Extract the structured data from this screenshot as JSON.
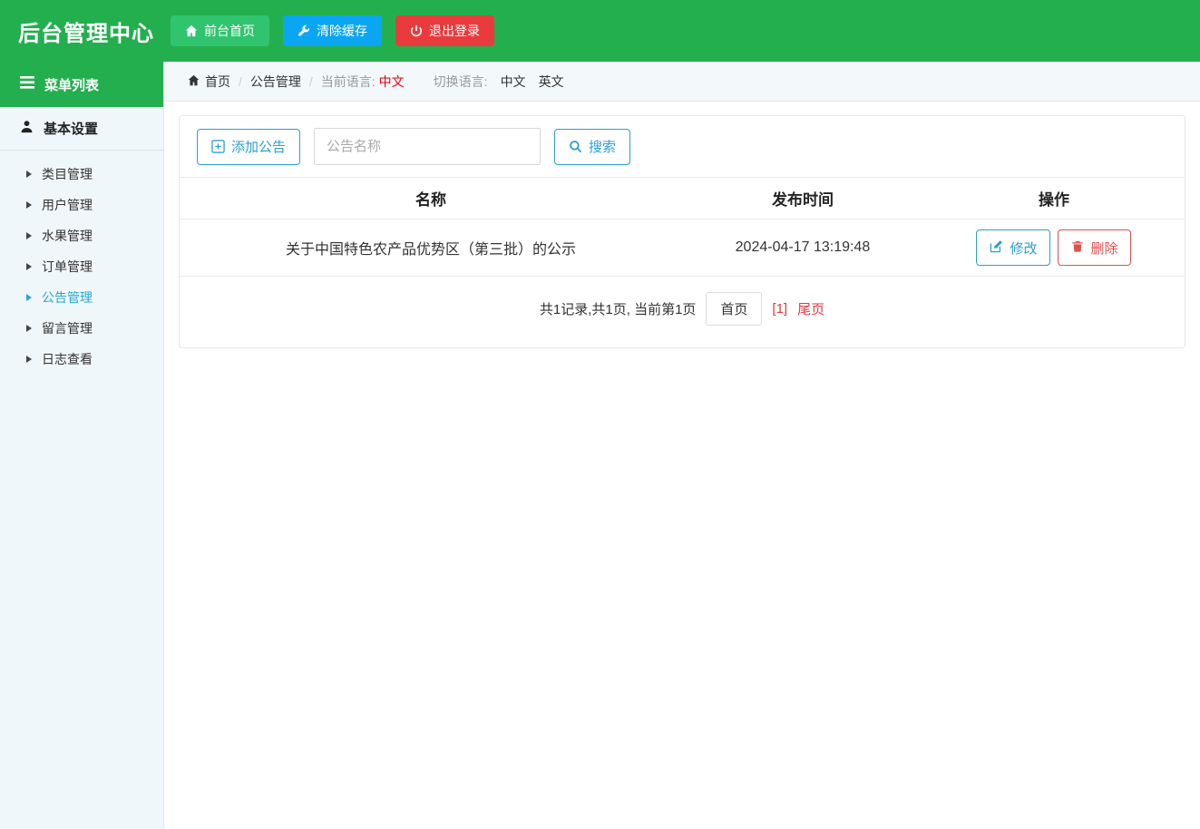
{
  "colors": {
    "header_green": "#24af4f",
    "button_green": "#30c46f",
    "button_blue": "#0aa6f2",
    "button_red": "#e93b3d",
    "accent_blue": "#2b9fd2",
    "active_menu_blue": "#2ba7cd",
    "danger_red": "#dd514c",
    "pager_red": "#e4393c",
    "lang_red": "#e60012",
    "sidebar_bg": "#f0f7fa"
  },
  "header": {
    "title": "后台管理中心",
    "buttons": [
      {
        "label": "前台首页",
        "icon": "home-icon"
      },
      {
        "label": "清除缓存",
        "icon": "wrench-icon"
      },
      {
        "label": "退出登录",
        "icon": "power-icon"
      }
    ]
  },
  "sidebar": {
    "menu_title": "菜单列表",
    "menu_title_icon": "list-icon",
    "group_title": "基本设置",
    "group_icon": "user-icon",
    "items": [
      {
        "label": "类目管理",
        "active": false
      },
      {
        "label": "用户管理",
        "active": false
      },
      {
        "label": "水果管理",
        "active": false
      },
      {
        "label": "订单管理",
        "active": false
      },
      {
        "label": "公告管理",
        "active": true
      },
      {
        "label": "留言管理",
        "active": false
      },
      {
        "label": "日志查看",
        "active": false
      }
    ]
  },
  "breadcrumb": {
    "home": "首页",
    "home_icon": "home-icon",
    "separator": "/",
    "section": "公告管理",
    "current_lang_label": "当前语言:",
    "current_lang": "中文",
    "switch_lang_label": "切换语言:",
    "lang_zh": "中文",
    "lang_en": "英文"
  },
  "toolbar": {
    "add_button": "添加公告",
    "add_icon": "plus-square-icon",
    "search_placeholder": "公告名称",
    "search_value": "",
    "search_button": "搜索",
    "search_icon": "search-icon"
  },
  "table": {
    "columns": [
      "名称",
      "发布时间",
      "操作"
    ],
    "rows": [
      {
        "name": "关于中国特色农产品优势区（第三批）的公示",
        "publish_time": "2024-04-17 13:19:48",
        "edit_label": "修改",
        "edit_icon": "edit-icon",
        "delete_label": "删除",
        "delete_icon": "trash-icon"
      }
    ]
  },
  "pagination": {
    "summary": "共1记录,共1页, 当前第1页",
    "first_page": "首页",
    "current_page": "[1]",
    "last_page": "尾页"
  }
}
